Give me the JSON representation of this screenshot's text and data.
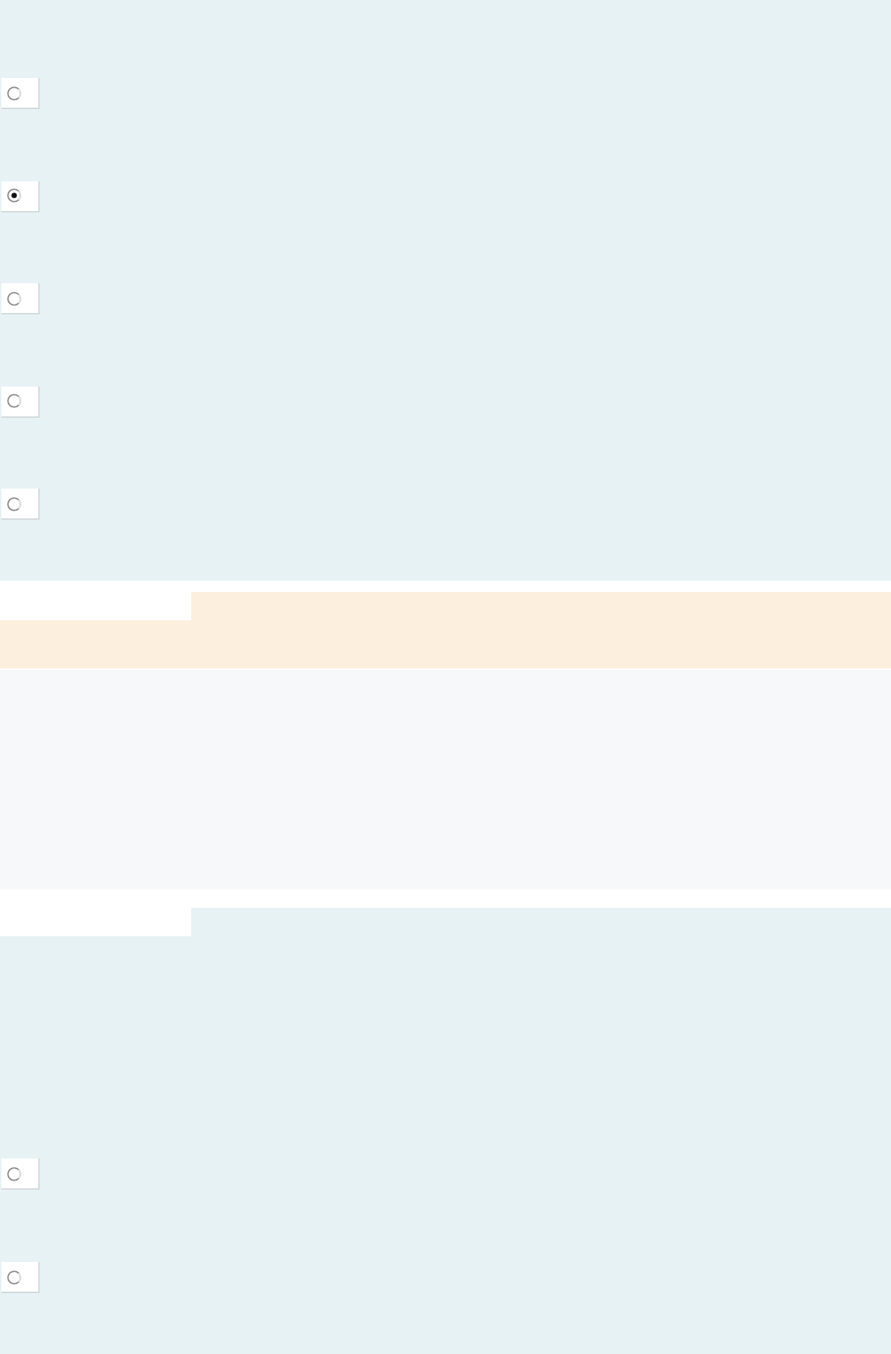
{
  "sections": [
    {
      "kind": "options",
      "notched": false,
      "options": [
        {
          "selected": false
        },
        {
          "selected": true
        },
        {
          "selected": false
        },
        {
          "selected": false
        },
        {
          "selected": false
        }
      ]
    },
    {
      "kind": "banner"
    },
    {
      "kind": "blank"
    },
    {
      "kind": "options",
      "notched": true,
      "options": [
        {
          "selected": false
        },
        {
          "selected": false
        }
      ]
    }
  ]
}
